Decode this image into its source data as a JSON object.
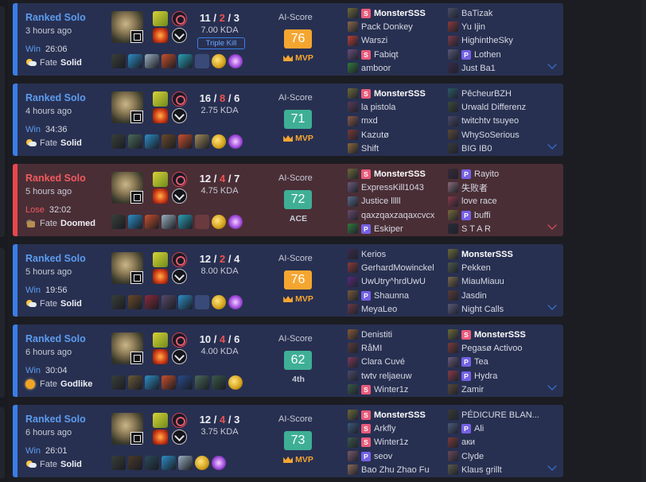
{
  "colors": {
    "win_accent": "#3a7ee8",
    "loss_accent": "#e8474c",
    "score_orange": "#f5a630",
    "score_teal": "#3eaf95",
    "badge_s": "#ea5a7a",
    "badge_p": "#7561e6"
  },
  "score_label": "AI-Score",
  "matches": [
    {
      "result": "win",
      "queue": "Ranked Solo",
      "ago": "3 hours ago",
      "wl": "Win",
      "duration": "26:06",
      "fate_label": "Fate",
      "fate": "Solid",
      "fate_icon": "sun-cloud-icon",
      "kills": "11",
      "deaths": "2",
      "assists": "3",
      "kda": "7.00 KDA",
      "tag": "Triple Kill",
      "score": "76",
      "score_color": "orange",
      "badge": "MVP",
      "badge_type": "mvp",
      "items": [
        "#3a3f3a",
        "#2d8ec7",
        "#9ab0c0",
        "#c9502c",
        "#2aa0b8",
        "empty",
        "ward",
        "lens"
      ],
      "team_a": [
        {
          "name": "MonsterSSS",
          "badge": "S",
          "icon": "#6d6a3a",
          "me": true
        },
        {
          "name": "Pack Donkey",
          "badge": "",
          "icon": "#8a6a4a"
        },
        {
          "name": "Warszi",
          "badge": "",
          "icon": "#b8403a"
        },
        {
          "name": "Fabiqt",
          "badge": "S",
          "icon": "#6a4f7a"
        },
        {
          "name": "amboor",
          "badge": "",
          "icon": "#2f7a3a"
        }
      ],
      "team_b": [
        {
          "name": "BaTizak",
          "badge": "",
          "icon": "#4a4f6a"
        },
        {
          "name": "Yu Ijin",
          "badge": "",
          "icon": "#8a3a3a"
        },
        {
          "name": "HighintheSky",
          "badge": "",
          "icon": "#7a3a4a"
        },
        {
          "name": "Lothen",
          "badge": "P",
          "icon": "#5a5a7a"
        },
        {
          "name": "Just Ba1",
          "badge": "",
          "icon": "#3a2a4a"
        }
      ]
    },
    {
      "result": "win",
      "queue": "Ranked Solo",
      "ago": "4 hours ago",
      "wl": "Win",
      "duration": "34:36",
      "fate_label": "Fate",
      "fate": "Solid",
      "fate_icon": "sun-cloud-icon",
      "kills": "16",
      "deaths": "8",
      "assists": "6",
      "kda": "2.75 KDA",
      "tag": "",
      "score": "71",
      "score_color": "teal",
      "badge": "MVP",
      "badge_type": "mvp",
      "items": [
        "#3a3f3a",
        "#4a6a5a",
        "#2d8ec7",
        "#6a4a2a",
        "#c9502c",
        "#a08a5a",
        "ward",
        "lens"
      ],
      "team_a": [
        {
          "name": "MonsterSSS",
          "badge": "S",
          "icon": "#6d6a3a",
          "me": true
        },
        {
          "name": "la pistola",
          "badge": "",
          "icon": "#5a3a5a"
        },
        {
          "name": "mxd",
          "badge": "",
          "icon": "#8a5a4a"
        },
        {
          "name": "Kazutø",
          "badge": "",
          "icon": "#7a3a3a"
        },
        {
          "name": "Shift",
          "badge": "",
          "icon": "#8a6a3a"
        }
      ],
      "team_b": [
        {
          "name": "PêcheurBZH",
          "badge": "",
          "icon": "#2a5a6a"
        },
        {
          "name": "Urwald Differenz",
          "badge": "",
          "icon": "#3a4a3a"
        },
        {
          "name": "twitchtv tsuyeo",
          "badge": "",
          "icon": "#4a4a6a"
        },
        {
          "name": "WhySoSerious",
          "badge": "",
          "icon": "#5a4a3a"
        },
        {
          "name": "BIG IB0",
          "badge": "",
          "icon": "#3a3a3a"
        }
      ]
    },
    {
      "result": "loss",
      "queue": "Ranked Solo",
      "ago": "5 hours ago",
      "wl": "Lose",
      "duration": "32:02",
      "fate_label": "Fate",
      "fate": "Doomed",
      "fate_icon": "doomed-icon",
      "kills": "12",
      "deaths": "4",
      "assists": "7",
      "kda": "4.75 KDA",
      "tag": "",
      "score": "72",
      "score_color": "teal",
      "badge": "ACE",
      "badge_type": "ace",
      "items": [
        "#3a3f3a",
        "#2d8ec7",
        "#c9502c",
        "#9ab0c0",
        "#2aa0b8",
        "empty",
        "ward",
        "lens"
      ],
      "team_a": [
        {
          "name": "MonsterSSS",
          "badge": "S",
          "icon": "#6d6a3a",
          "me": true
        },
        {
          "name": "ExpressKill1043",
          "badge": "",
          "icon": "#6a5a7a"
        },
        {
          "name": "Justice lllll",
          "badge": "",
          "icon": "#5a6a8a"
        },
        {
          "name": "qaxzqaxzaqaxcvcx",
          "badge": "",
          "icon": "#6a4a6a"
        },
        {
          "name": "Eskiper",
          "badge": "P",
          "icon": "#2f7a3a"
        }
      ],
      "team_b": [
        {
          "name": "Rayito",
          "badge": "P",
          "icon": "#3a2a3a"
        },
        {
          "name": "失败者",
          "badge": "",
          "icon": "#8a6a7a"
        },
        {
          "name": "love race",
          "badge": "",
          "icon": "#8a3a4a"
        },
        {
          "name": "buffi",
          "badge": "P",
          "icon": "#7a6a3a"
        },
        {
          "name": "S T A R",
          "badge": "",
          "icon": "#2a2a3a"
        }
      ]
    },
    {
      "result": "win",
      "queue": "Ranked Solo",
      "ago": "5 hours ago",
      "wl": "Win",
      "duration": "19:56",
      "fate_label": "Fate",
      "fate": "Solid",
      "fate_icon": "sun-cloud-icon",
      "kills": "12",
      "deaths": "2",
      "assists": "4",
      "kda": "8.00 KDA",
      "tag": "",
      "score": "76",
      "score_color": "orange",
      "badge": "MVP",
      "badge_type": "mvp",
      "items": [
        "#3a3f3a",
        "#6a4a2a",
        "#8a2a3a",
        "#5a4a6a",
        "#2d8ec7",
        "empty",
        "ward",
        "lens"
      ],
      "team_a": [
        {
          "name": "Kerios",
          "badge": "",
          "icon": "#3a2a4a"
        },
        {
          "name": "GerhardMowinckel",
          "badge": "",
          "icon": "#8a3a3a"
        },
        {
          "name": "UwUtry^hrdUwU",
          "badge": "",
          "icon": "#5a2a7a"
        },
        {
          "name": "Shaunna",
          "badge": "P",
          "icon": "#7a5a3a"
        },
        {
          "name": "MeyaLeo",
          "badge": "",
          "icon": "#6a3a4a"
        }
      ],
      "team_b": [
        {
          "name": "MonsterSSS",
          "badge": "",
          "icon": "#6d6a3a",
          "me": true
        },
        {
          "name": "Pekken",
          "badge": "",
          "icon": "#4a5a4a"
        },
        {
          "name": "MiauMiauu",
          "badge": "",
          "icon": "#7a6a4a"
        },
        {
          "name": "Jasdin",
          "badge": "",
          "icon": "#5a3a3a"
        },
        {
          "name": "Night Calls",
          "badge": "",
          "icon": "#5a5a7a"
        }
      ]
    },
    {
      "result": "win",
      "queue": "Ranked Solo",
      "ago": "6 hours ago",
      "wl": "Win",
      "duration": "30:04",
      "fate_label": "Fate",
      "fate": "Godlike",
      "fate_icon": "godlike-sun-icon",
      "kills": "10",
      "deaths": "4",
      "assists": "6",
      "kda": "4.00 KDA",
      "tag": "",
      "score": "62",
      "score_color": "teal",
      "badge": "4th",
      "badge_type": "fourth",
      "items": [
        "#3a3f3a",
        "#6a5a3a",
        "#2d8ec7",
        "#c9502c",
        "#2a4a8a",
        "#4a6a5a",
        "#3a5a4a",
        "ward"
      ],
      "team_a": [
        {
          "name": "Denistiti",
          "badge": "",
          "icon": "#8a5a3a"
        },
        {
          "name": "RåMI",
          "badge": "",
          "icon": "#5a3a3a"
        },
        {
          "name": "Clara Cuvé",
          "badge": "",
          "icon": "#7a3a5a"
        },
        {
          "name": "twtv reljaeuw",
          "badge": "",
          "icon": "#4a4a6a"
        },
        {
          "name": "Winter1z",
          "badge": "S",
          "icon": "#3a5a4a"
        }
      ],
      "team_b": [
        {
          "name": "MonsterSSS",
          "badge": "S",
          "icon": "#6d6a3a",
          "me": true
        },
        {
          "name": "Pegasø Activoo",
          "badge": "",
          "icon": "#7a3a3a"
        },
        {
          "name": "Tea",
          "badge": "P",
          "icon": "#6a5a7a"
        },
        {
          "name": "Hydra",
          "badge": "P",
          "icon": "#8a3a4a"
        },
        {
          "name": "Zamir",
          "badge": "",
          "icon": "#5a4a3a"
        }
      ]
    },
    {
      "result": "win",
      "queue": "Ranked Solo",
      "ago": "6 hours ago",
      "wl": "Win",
      "duration": "26:01",
      "fate_label": "Fate",
      "fate": "Solid",
      "fate_icon": "sun-cloud-icon",
      "kills": "12",
      "deaths": "4",
      "assists": "3",
      "kda": "3.75 KDA",
      "tag": "",
      "score": "73",
      "score_color": "teal",
      "badge": "MVP",
      "badge_type": "mvp",
      "items": [
        "#3a3f3a",
        "#4a3a2a",
        "#2a4a5a",
        "#2d8ec7",
        "#9ab0c0",
        "ward",
        "lens"
      ],
      "team_a": [
        {
          "name": "MonsterSSS",
          "badge": "S",
          "icon": "#6d6a3a",
          "me": true
        },
        {
          "name": "Arkfly",
          "badge": "S",
          "icon": "#3a5a7a"
        },
        {
          "name": "Winter1z",
          "badge": "S",
          "icon": "#3a5a4a"
        },
        {
          "name": "seov",
          "badge": "P",
          "icon": "#7a5a6a"
        },
        {
          "name": "Bao Zhu Zhao Fu",
          "badge": "",
          "icon": "#8a6a5a"
        }
      ],
      "team_b": [
        {
          "name": "PÉDICURE BLAN...",
          "badge": "",
          "icon": "#3a3a3a"
        },
        {
          "name": "Ali",
          "badge": "P",
          "icon": "#4a5a7a"
        },
        {
          "name": "аки",
          "badge": "",
          "icon": "#7a3a3a"
        },
        {
          "name": "Clyde",
          "badge": "",
          "icon": "#6a4a5a"
        },
        {
          "name": "Klaus grillt",
          "badge": "",
          "icon": "#5a5a4a"
        }
      ]
    }
  ]
}
